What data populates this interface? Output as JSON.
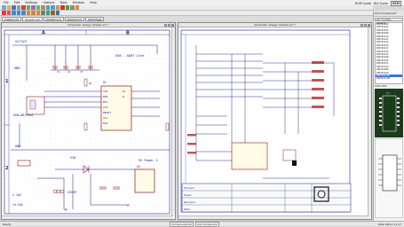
{
  "menu": [
    "File",
    "Edit",
    "Settings",
    "Options",
    "Tools",
    "Window",
    "Help"
  ],
  "right_tools": {
    "bom": "BOM Quote",
    "bid": "Bid Quote",
    "hsm": "HSM"
  },
  "tabs": [
    {
      "label": "sheet1.sch",
      "active": false
    },
    {
      "label": "Sheet1.sch",
      "active": true
    },
    {
      "label": "Sheet2.sch",
      "active": false
    },
    {
      "label": "sheet3.sch",
      "active": false
    },
    {
      "label": "Start Page",
      "active": false
    }
  ],
  "left_window": {
    "title": "Schematic Design Sheet1.sch *",
    "cols": [
      "A",
      "B"
    ],
    "rows": [
      "1",
      "2"
    ],
    "labels": {
      "vcc3v3": "VCC3V3",
      "usb_uart": "USB - UART Inte",
      "gnd": "GND",
      "usb_mini": "USB—AB—MINI",
      "v_in": "VIN",
      "pwr": "5V Power 1",
      "vchip": "VCHIP",
      "c1": "C1",
      "c2": "C2",
      "c3": "C3",
      "r1": "R1",
      "r2": "R2",
      "u1": "U1",
      "u2": "U2",
      "txd": "TXD",
      "rxd": "RXD",
      "rts": "RTS",
      "cts": "CTS",
      "reset": "RESET",
      "vcc": "VCC",
      "dcd": "DCD",
      "d_plus": "D+",
      "d_minus": "D-",
      "ai1": "2.1AH",
      "x14": "14.10A"
    }
  },
  "right_window": {
    "title": "Schematic Design Sheet3.sch *",
    "title_block": [
      "Project",
      "Sheet",
      "Designer",
      "Date"
    ]
  },
  "add_component": {
    "title": "Add Component",
    "search": "Lib: TI_Chips - Library1",
    "items": [
      "DM74LS00",
      "DM74LS02",
      "DM74LS04",
      "DM74LS08",
      "DM74LS10",
      "DM74LS11",
      "DM74LS14",
      "DM74LS20",
      "DM74LS27",
      "DM74LS30",
      "DM74LS32",
      "DM74LS38",
      "DM74LS42",
      "DM74LS51",
      "DM74LS74",
      "DM74LS86",
      "DM74LS90",
      "DM74LS125",
      "DM74LS138"
    ],
    "selected_index": 17,
    "preview_label": "DIP14-300",
    "ref": "U?"
  },
  "status": {
    "left": "Ready",
    "right": "Date 09/21 11:17",
    "tabs": [
      "Components Lib",
      "Add Component"
    ]
  },
  "colors": {
    "wire": "#1d1d8a",
    "component": "#8b1a1a",
    "grid": "#e6e6f0",
    "label": "#1a1aa0",
    "accent": "#3875d7"
  }
}
